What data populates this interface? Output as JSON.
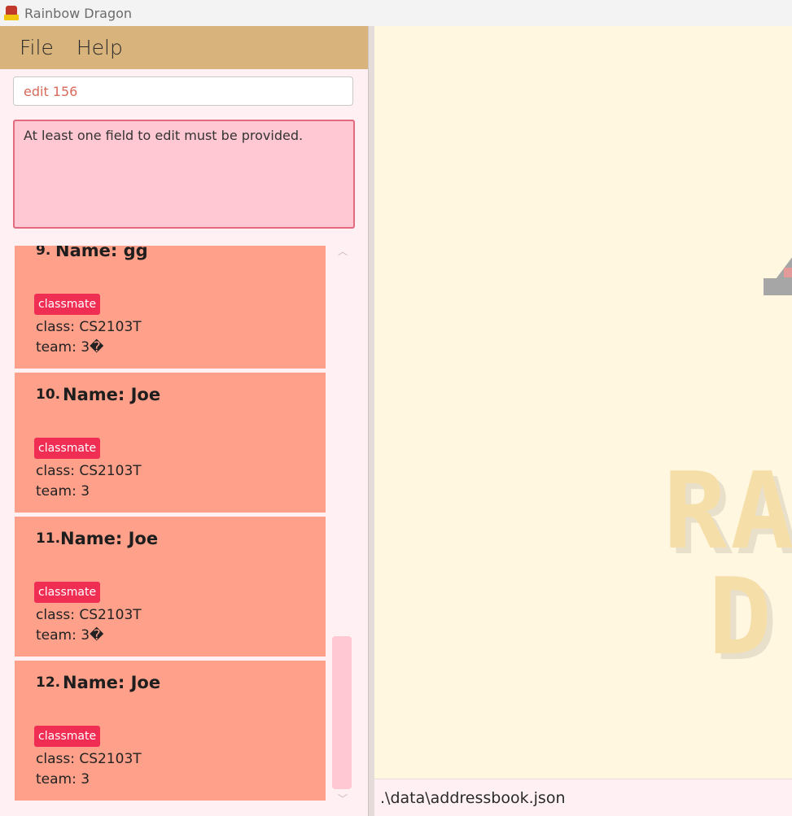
{
  "window": {
    "title": "Rainbow Dragon",
    "icon": "rainbow-dragon-app-icon"
  },
  "menu": {
    "file_label": "File",
    "help_label": "Help"
  },
  "command": {
    "value": "edit 156"
  },
  "result": {
    "message": "At least one field to edit must be provided."
  },
  "persons": [
    {
      "index": "9.",
      "name": "Name: gg",
      "tag": "classmate",
      "class": "class: CS2103T",
      "team": "team: 3�"
    },
    {
      "index": "10.",
      "name": "Name: Joe",
      "tag": "classmate",
      "class": "class: CS2103T",
      "team": "team: 3"
    },
    {
      "index": "11.",
      "name": "Name: Joe",
      "tag": "classmate",
      "class": "class: CS2103T",
      "team": "team: 3�"
    },
    {
      "index": "12.",
      "name": "Name: Joe",
      "tag": "classmate",
      "class": "class: CS2103T",
      "team": "team: 3"
    }
  ],
  "logo": {
    "line1": "RA",
    "line2": "D"
  },
  "status": {
    "file_path": ".\\data\\addressbook.json"
  },
  "colors": {
    "menubar": "#d8b47c",
    "card": "#ffa08a",
    "tag": "#f02d52",
    "result_bg": "#ffc8d3",
    "right_pane": "#fff7e0"
  }
}
